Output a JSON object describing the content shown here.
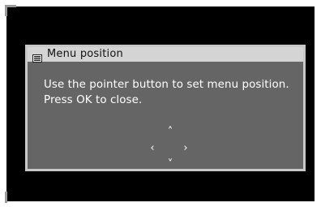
{
  "dialog": {
    "title": "Menu position",
    "title_icon": "menu-icon",
    "message_line_1": "Use the pointer button to set menu position.",
    "message_line_2": "Press OK to close."
  },
  "pointer": {
    "up_glyph": "˄",
    "left_glyph": "‹",
    "right_glyph": "›",
    "down_glyph": "˅"
  },
  "colors": {
    "screen_background": "#000000",
    "dialog_background": "#656565",
    "titlebar_background": "#d4d4d4",
    "dialog_border": "#c8c8c8",
    "text": "#ffffff"
  }
}
